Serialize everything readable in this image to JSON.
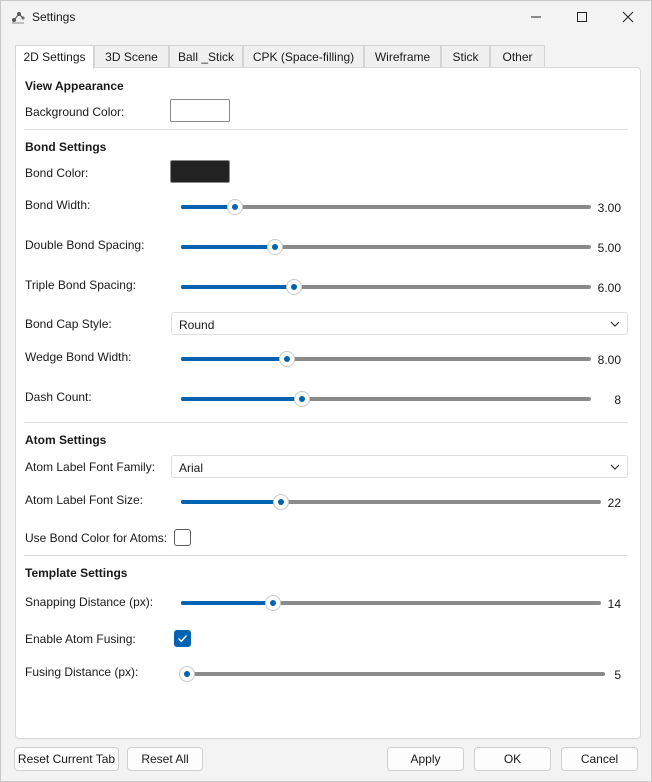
{
  "window": {
    "title": "Settings",
    "app_icon": "molecule-icon",
    "controls": [
      "minimize-icon",
      "maximize-icon",
      "close-icon"
    ]
  },
  "tabs": [
    {
      "label": "2D Settings",
      "active": true
    },
    {
      "label": "3D Scene",
      "active": false
    },
    {
      "label": "Ball _Stick",
      "active": false
    },
    {
      "label": "CPK (Space-filling)",
      "active": false
    },
    {
      "label": "Wireframe",
      "active": false
    },
    {
      "label": "Stick",
      "active": false
    },
    {
      "label": "Other",
      "active": false
    }
  ],
  "view_appearance": {
    "title": "View Appearance",
    "background_color_label": "Background Color:",
    "background_color": "#ffffff"
  },
  "bond_settings": {
    "title": "Bond Settings",
    "bond_color_label": "Bond Color:",
    "bond_color": "#222222",
    "bond_width": {
      "label": "Bond Width:",
      "value": "3.00",
      "fraction": 0.12
    },
    "double_bond_spacing": {
      "label": "Double Bond Spacing:",
      "value": "5.00",
      "fraction": 0.22
    },
    "triple_bond_spacing": {
      "label": "Triple Bond Spacing:",
      "value": "6.00",
      "fraction": 0.27
    },
    "bond_cap_style": {
      "label": "Bond Cap Style:",
      "value": "Round"
    },
    "wedge_bond_width": {
      "label": "Wedge Bond Width:",
      "value": "8.00",
      "fraction": 0.25
    },
    "dash_count": {
      "label": "Dash Count:",
      "value": "8",
      "fraction": 0.29
    }
  },
  "atom_settings": {
    "title": "Atom Settings",
    "font_family": {
      "label": "Atom Label Font Family:",
      "value": "Arial"
    },
    "font_size": {
      "label": "Atom Label Font Size:",
      "value": "22",
      "fraction": 0.23
    },
    "use_bond_color": {
      "label": "Use Bond Color for Atoms:",
      "checked": false
    }
  },
  "template_settings": {
    "title": "Template Settings",
    "snapping_distance": {
      "label": "Snapping Distance (px):",
      "value": "14",
      "fraction": 0.21
    },
    "enable_atom_fusing": {
      "label": "Enable Atom Fusing:",
      "checked": true
    },
    "fusing_distance": {
      "label": "Fusing Distance (px):",
      "value": "5",
      "fraction": 0.0
    }
  },
  "footer": {
    "reset_tab": "Reset Current Tab",
    "reset_all": "Reset All",
    "apply": "Apply",
    "ok": "OK",
    "cancel": "Cancel"
  },
  "colors": {
    "accent": "#0063b1",
    "track": "#8b8b8b"
  }
}
